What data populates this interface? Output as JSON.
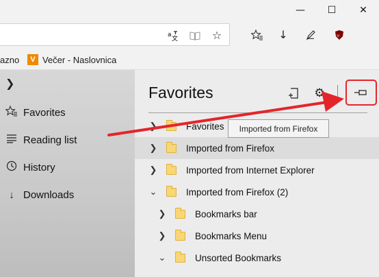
{
  "window": {
    "minimize_icon": "minimize-icon",
    "maximize_icon": "maximize-icon",
    "close_icon": "close-icon"
  },
  "toolbar": {
    "icons": [
      "translate-icon",
      "reading-view-icon",
      "add-favorite-star-icon",
      "favorites-hub-icon",
      "downloads-arrow-icon",
      "web-note-pen-icon",
      "ublock-origin-icon"
    ]
  },
  "favorites_bar": {
    "partial_item": "azno",
    "items": [
      {
        "label": "Večer - Naslovnica",
        "icon": "V"
      }
    ]
  },
  "hub": {
    "expand_icon": "chevron-right-icon",
    "items": [
      {
        "label": "Favorites",
        "icon": "favorites-icon"
      },
      {
        "label": "Reading list",
        "icon": "reading-list-icon"
      },
      {
        "label": "History",
        "icon": "history-icon"
      },
      {
        "label": "Downloads",
        "icon": "download-icon"
      }
    ]
  },
  "panel": {
    "title": "Favorites",
    "tooltip": "Imported from Firefox",
    "folders": [
      {
        "label": "Favorites",
        "expanded": false,
        "level": 0
      },
      {
        "label": "Imported from Firefox",
        "expanded": false,
        "level": 0,
        "highlighted": true
      },
      {
        "label": "Imported from Internet Explorer",
        "expanded": false,
        "level": 0
      },
      {
        "label": "Imported from Firefox (2)",
        "expanded": true,
        "level": 0
      },
      {
        "label": "Bookmarks bar",
        "expanded": false,
        "level": 1
      },
      {
        "label": "Bookmarks Menu",
        "expanded": false,
        "level": 1
      },
      {
        "label": "Unsorted Bookmarks",
        "expanded": true,
        "level": 1
      }
    ]
  },
  "annotation": {
    "color": "#e3252b"
  }
}
